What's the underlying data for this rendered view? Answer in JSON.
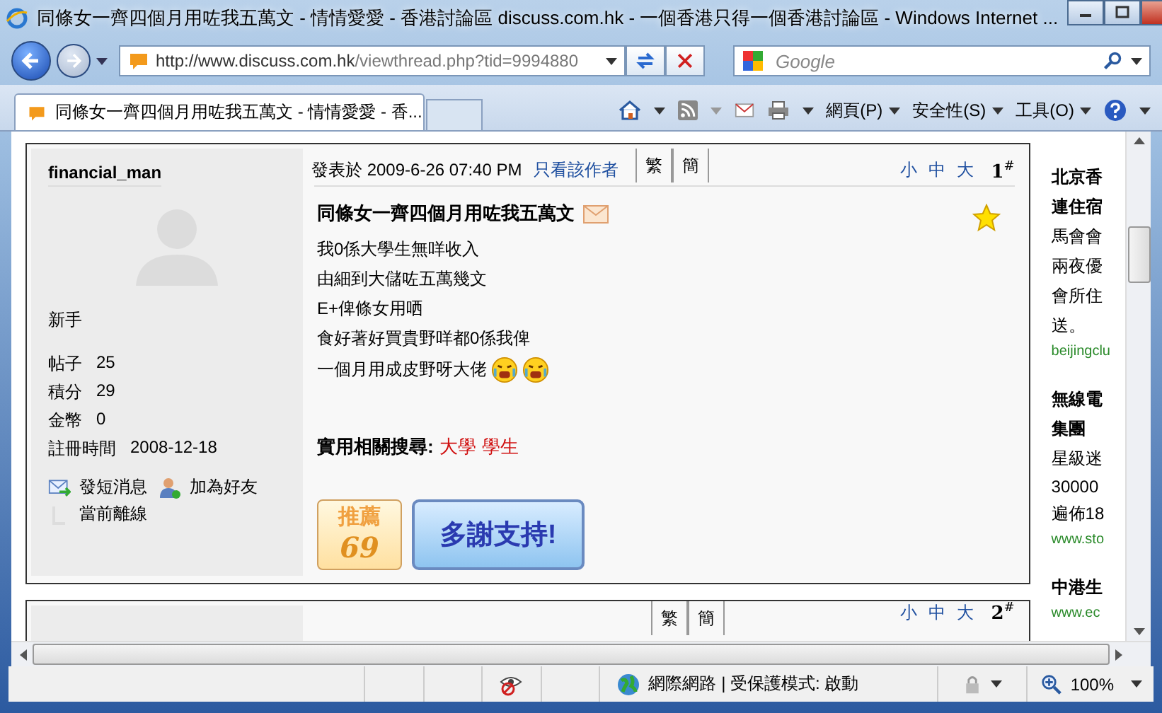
{
  "window": {
    "title": "同條女一齊四個月用咗我五萬文 - 情情愛愛 - 香港討論區 discuss.com.hk - 一個香港只得一個香港討論區 - Windows Internet ..."
  },
  "address": {
    "value_host": "http://www.discuss.com.hk",
    "value_path": "/viewthread.php?tid=9994880"
  },
  "search": {
    "placeholder": "Google"
  },
  "tabs": [
    {
      "label": "同條女一齊四個月用咗我五萬文 - 情情愛愛 - 香...",
      "selected": true
    }
  ],
  "menus": [
    "網頁(P)",
    "安全性(S)",
    "工具(O)"
  ],
  "post": {
    "author": "financial_man",
    "rank": "新手",
    "stats": [
      {
        "label": "帖子",
        "value": "25"
      },
      {
        "label": "積分",
        "value": "29"
      },
      {
        "label": "金幣",
        "value": "0"
      },
      {
        "label": "註冊時間",
        "value": "2008-12-18"
      }
    ],
    "actions": [
      {
        "kind": "message",
        "label": "發短消息"
      },
      {
        "kind": "friend",
        "label": "加為好友"
      }
    ],
    "online_status": "當前離線",
    "posted": "發表於 2009-6-26 07:40 PM",
    "only_author": "只看該作者",
    "lang_buttons": [
      "繁",
      "簡"
    ],
    "font_sizes": [
      "小",
      "中",
      "大"
    ],
    "floor": "1",
    "floor_mark": "#",
    "title": "同條女一齊四個月用咗我五萬文",
    "lines": [
      "我0係大學生無咩收入",
      "由細到大儲咗五萬幾文",
      "E+俾條女用哂",
      "食好著好買貴野咩都0係我俾",
      "一個月用成皮野呀大佬"
    ],
    "related_label": "實用相關搜尋:",
    "related_links": [
      "大學",
      "學生"
    ],
    "recommend": {
      "label": "推薦",
      "count": "69"
    },
    "thanks": "多謝支持!"
  },
  "next_post": {
    "lang_buttons": [
      "繁",
      "簡"
    ],
    "font_sizes": [
      "小",
      "中",
      "大"
    ],
    "floor": "2",
    "floor_mark": "#"
  },
  "ads": [
    {
      "title_lines": [
        "北京香",
        "連住宿"
      ],
      "body_lines": [
        "馬會會",
        "兩夜優",
        "會所住",
        "送。"
      ],
      "url": "beijingclu"
    },
    {
      "title_lines": [
        "無線電",
        "集團"
      ],
      "body_lines": [
        "星級迷",
        "30000",
        "遍佈18"
      ],
      "url": "www.sto"
    },
    {
      "title_lines": [
        "中港生"
      ],
      "url": "www.ec"
    }
  ],
  "status_bar": {
    "zone": "網際網路 | 受保護模式: 啟動",
    "zoom": "100%"
  }
}
